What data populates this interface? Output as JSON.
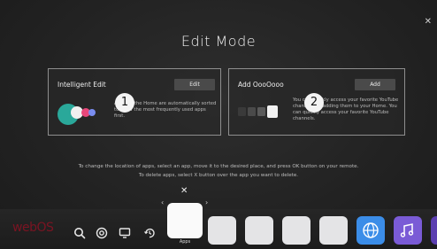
{
  "screen": {
    "title": "Edit Mode",
    "close_icon": "close-icon"
  },
  "cards": {
    "intelligent_edit": {
      "title": "Intelligent Edit",
      "button": "Edit",
      "description": "Arrange the Home are automatically sorted to show the most frequently used apps first.",
      "badge": "1"
    },
    "add": {
      "title": "Add OooOooo",
      "button": "Add",
      "description": "You can quickly access your favorite YouTube channels by adding them to your Home. You can quickly access your favorite YouTube channels.",
      "badge": "2"
    }
  },
  "instructions": {
    "line1": "To change the location of apps, select an app, move it to the desired place, and press OK button on your remote.",
    "line2": "To delete apps, select X button over the app you want to delete."
  },
  "launcher": {
    "logo": "webOS",
    "selected_label": "Apps",
    "delete_icon": "close-icon",
    "system_icons": [
      "search-icon",
      "settings-icon",
      "input-icon",
      "recents-icon"
    ],
    "app_icons": [
      "globe-icon",
      "music-icon"
    ],
    "colors": {
      "globe": "#3b8de8",
      "music": "#7a5bd6",
      "logo": "#7a1422"
    }
  }
}
